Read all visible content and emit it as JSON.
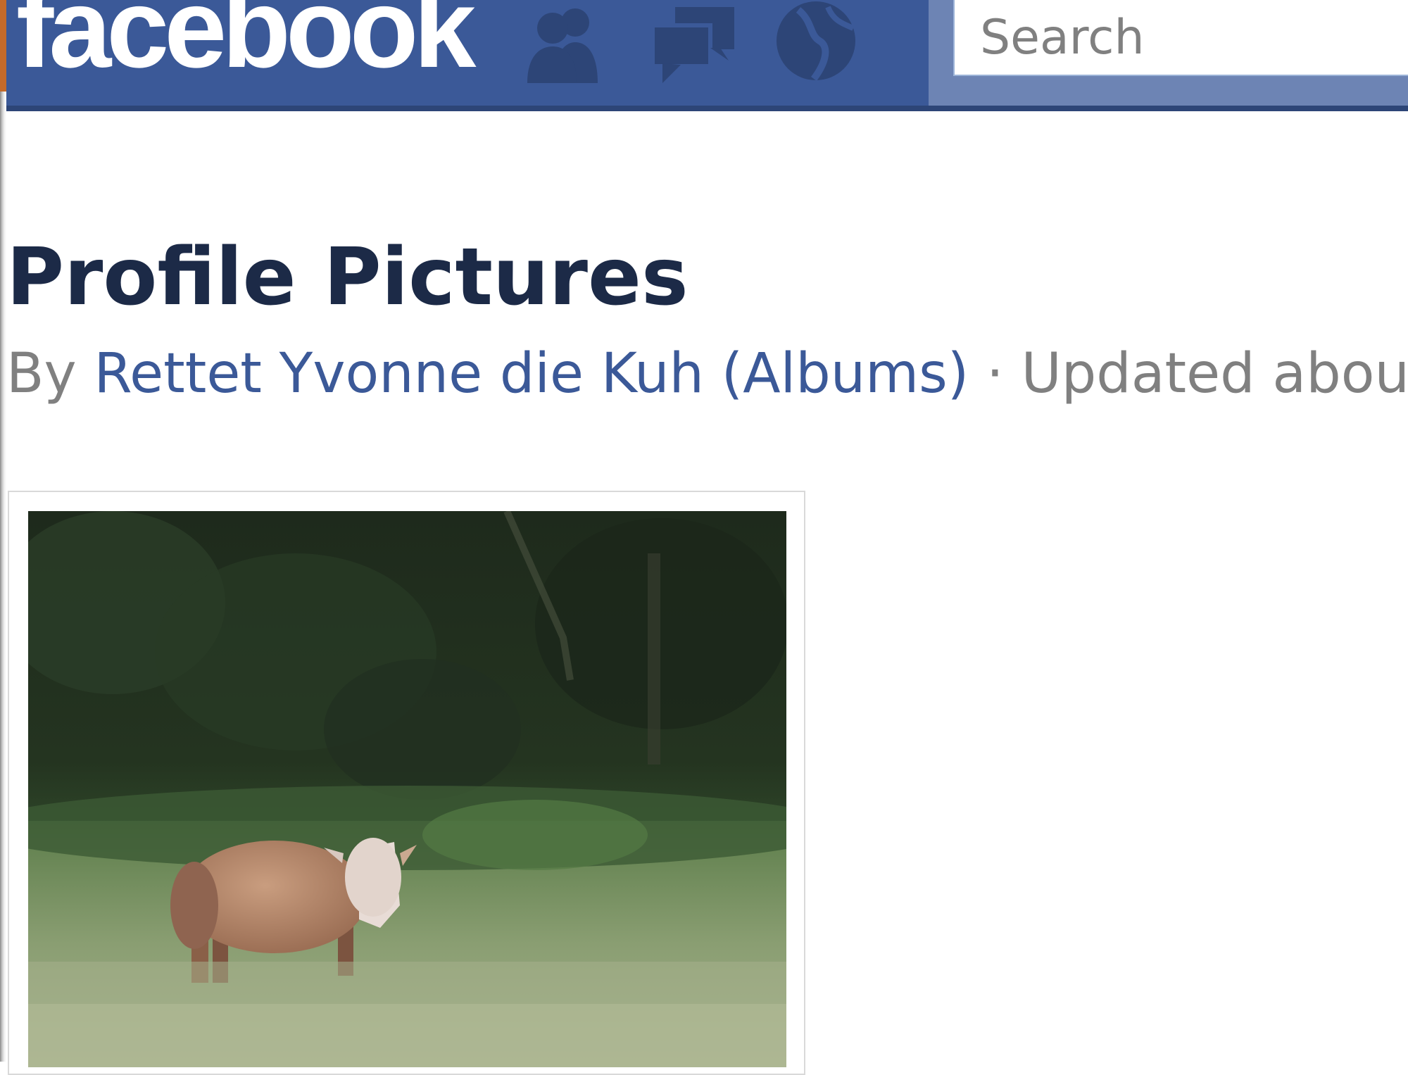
{
  "header": {
    "logo_text": "facebook",
    "brand_color": "#3b5998",
    "jewels": [
      "friend-requests-icon",
      "messages-icon",
      "notifications-globe-icon"
    ],
    "search": {
      "placeholder": "Search",
      "value": ""
    }
  },
  "album": {
    "title": "Profile Pictures",
    "by_prefix": "By",
    "owner_name": "Rettet Yvonne die Kuh",
    "albums_link": "(Albums)",
    "separator": "·",
    "updated_text": "Updated about"
  },
  "photo": {
    "subject": "cow-in-meadow-photo"
  }
}
